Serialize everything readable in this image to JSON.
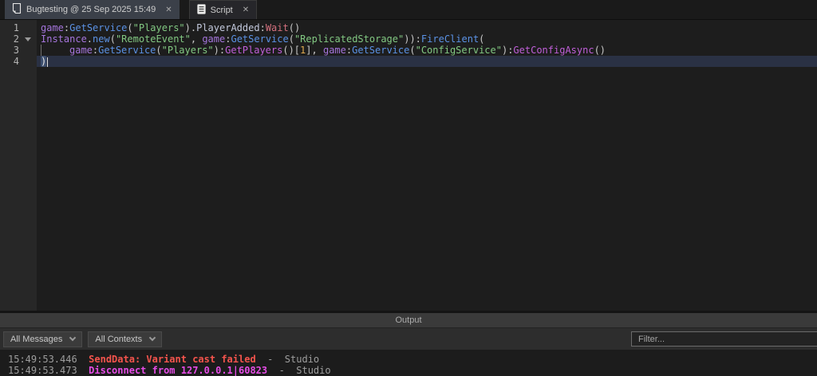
{
  "tabs": [
    {
      "label": "Bugtesting @ 25 Sep 2025 15:49",
      "icon": "place-document-icon",
      "active": false
    },
    {
      "label": "Script",
      "icon": "script-icon",
      "active": true
    }
  ],
  "icons": {
    "close_glyph": "✕"
  },
  "colors": {
    "global": "#a575dc",
    "method_blue": "#5b92e5",
    "method_magenta": "#c05fd9",
    "string_green": "#82c882",
    "number_orange": "#e0aa50",
    "deprecated_rose": "#d4707e",
    "error_red": "#f5544d",
    "disconnect_magenta": "#e64ce6",
    "current_line": "#2a3144"
  },
  "editor": {
    "lines": [
      {
        "num": "1",
        "fold": false,
        "current": false,
        "guide": false,
        "tokens": [
          {
            "t": "game",
            "c": "global"
          },
          {
            "t": ":",
            "c": "plain"
          },
          {
            "t": "GetService",
            "c": "method"
          },
          {
            "t": "(",
            "c": "plain"
          },
          {
            "t": "\"Players\"",
            "c": "string"
          },
          {
            "t": ").",
            "c": "plain"
          },
          {
            "t": "PlayerAdded",
            "c": "property"
          },
          {
            "t": ":",
            "c": "plain"
          },
          {
            "t": "Wait",
            "c": "deprecated"
          },
          {
            "t": "()",
            "c": "plain"
          }
        ]
      },
      {
        "num": "2",
        "fold": true,
        "current": false,
        "guide": false,
        "tokens": [
          {
            "t": "Instance",
            "c": "global"
          },
          {
            "t": ".",
            "c": "plain"
          },
          {
            "t": "new",
            "c": "method"
          },
          {
            "t": "(",
            "c": "plain"
          },
          {
            "t": "\"RemoteEvent\"",
            "c": "string"
          },
          {
            "t": ", ",
            "c": "plain"
          },
          {
            "t": "game",
            "c": "global"
          },
          {
            "t": ":",
            "c": "plain"
          },
          {
            "t": "GetService",
            "c": "method"
          },
          {
            "t": "(",
            "c": "plain"
          },
          {
            "t": "\"ReplicatedStorage\"",
            "c": "string"
          },
          {
            "t": ")):",
            "c": "plain"
          },
          {
            "t": "FireClient",
            "c": "method"
          },
          {
            "t": "(",
            "c": "plain"
          }
        ]
      },
      {
        "num": "3",
        "fold": false,
        "current": false,
        "guide": true,
        "tokens": [
          {
            "t": "",
            "c": "indent"
          },
          {
            "t": "game",
            "c": "global"
          },
          {
            "t": ":",
            "c": "plain"
          },
          {
            "t": "GetService",
            "c": "method"
          },
          {
            "t": "(",
            "c": "plain"
          },
          {
            "t": "\"Players\"",
            "c": "string"
          },
          {
            "t": "):",
            "c": "plain"
          },
          {
            "t": "GetPlayers",
            "c": "method2"
          },
          {
            "t": "()[",
            "c": "plain"
          },
          {
            "t": "1",
            "c": "number"
          },
          {
            "t": "], ",
            "c": "plain"
          },
          {
            "t": "game",
            "c": "global"
          },
          {
            "t": ":",
            "c": "plain"
          },
          {
            "t": "GetService",
            "c": "method"
          },
          {
            "t": "(",
            "c": "plain"
          },
          {
            "t": "\"ConfigService\"",
            "c": "string"
          },
          {
            "t": "):",
            "c": "plain"
          },
          {
            "t": "GetConfigAsync",
            "c": "method2"
          },
          {
            "t": "()",
            "c": "plain"
          }
        ]
      },
      {
        "num": "4",
        "fold": false,
        "current": true,
        "guide": false,
        "caret": true,
        "tokens": [
          {
            "t": ")",
            "c": "bracket"
          }
        ]
      }
    ]
  },
  "output": {
    "title": "Output",
    "dropdowns": [
      {
        "label": "All Messages"
      },
      {
        "label": "All Contexts"
      }
    ],
    "filter_placeholder": "Filter...",
    "log": [
      {
        "time": "15:49:53.446",
        "message": "SendData: Variant cast failed",
        "sep": "-",
        "context": "Studio",
        "type": "error"
      },
      {
        "time": "15:49:53.473",
        "message": "Disconnect from 127.0.0.1|60823",
        "sep": "-",
        "context": "Studio",
        "type": "pink"
      }
    ]
  }
}
